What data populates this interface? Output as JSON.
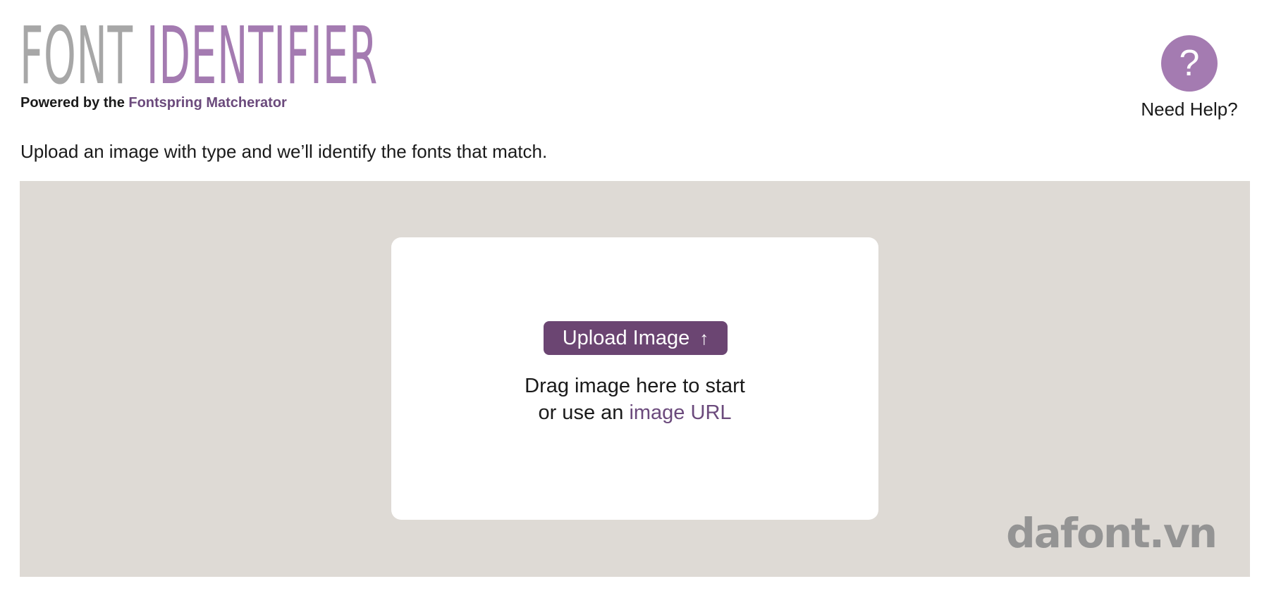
{
  "header": {
    "title_part1": "FONT",
    "title_part2": "IDENTIFIER",
    "powered_prefix": "Powered by the",
    "powered_link": "Fontspring Matcherator"
  },
  "help": {
    "icon_glyph": "?",
    "label": "Need Help?"
  },
  "tagline": "Upload an image with type and we’ll identify the fonts that match.",
  "upload": {
    "button_label": "Upload Image",
    "button_icon": "↑",
    "drag_line1": "Drag image here to start",
    "drag_line2_prefix": "or use an",
    "url_link": "image URL"
  },
  "watermark": "dafont.vn",
  "colors": {
    "accent": "#a47bb1",
    "button": "#6b4572",
    "link": "#6b4a7c",
    "dropzone_bg": "#dedad5"
  }
}
